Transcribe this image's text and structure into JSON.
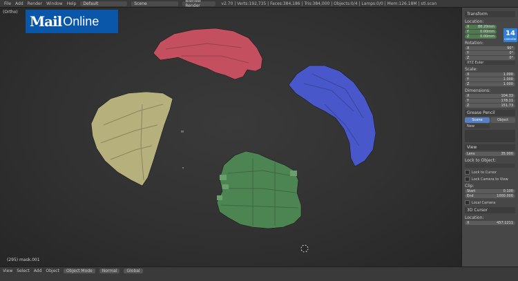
{
  "logo": {
    "mail": "Mail",
    "online": "Online"
  },
  "topbar": {
    "menus": [
      "File",
      "Add",
      "Render",
      "Window",
      "Help"
    ],
    "layout_field": "Default",
    "scene_field": "Scene",
    "engine_field": "Blender Render",
    "info": "v2.70 | Verts:192,735 | Faces:384,186 | Tris:384,000 | Objects:0/4 | Lamps:0/0 | Mem:126.18M | stl.scan"
  },
  "viewport": {
    "view_label": "(Ortho)",
    "status": "(295) mask.001"
  },
  "pieces": {
    "colors": {
      "red": "#c4505f",
      "blue": "#4857c9",
      "tan": "#b5b07c",
      "green": "#4c8552"
    }
  },
  "panel": {
    "transform_title": "Transform",
    "location_label": "Location:",
    "location": [
      "88.20mm",
      "0.00mm",
      "0.00mm"
    ],
    "rotation_label": "Rotation:",
    "rotation": [
      "90°",
      "0°",
      "0°"
    ],
    "rotation_mode": "XYZ Euler",
    "scale_label": "Scale:",
    "scale": [
      "1.000",
      "1.000",
      "1.000"
    ],
    "dimensions_label": "Dimensions:",
    "dimensions": [
      "104.33",
      "178.11",
      "151.73"
    ],
    "grease_title": "Grease Pencil",
    "grease_tabs": [
      "Scene",
      "Object"
    ],
    "grease_new": "New",
    "view_title": "View",
    "lens_label": "Lens",
    "lens_value": "35.000",
    "lock_label": "Lock to Object:",
    "lock_cursor": "Lock to Cursor",
    "lock_camera": "Lock Camera to View",
    "clip_label": "Clip:",
    "clip_start": "0.100",
    "clip_end": "1000.000",
    "local_camera": "Local Camera",
    "cursor_title": "3D Cursor",
    "cursor_location": "Location:",
    "cursor_x": "457.1211",
    "calendar": {
      "day": "14",
      "label": "calendar"
    }
  },
  "bottombar": {
    "items": [
      "View",
      "Select",
      "Add",
      "Object",
      "Object Mode",
      "Normal",
      "Global"
    ]
  }
}
